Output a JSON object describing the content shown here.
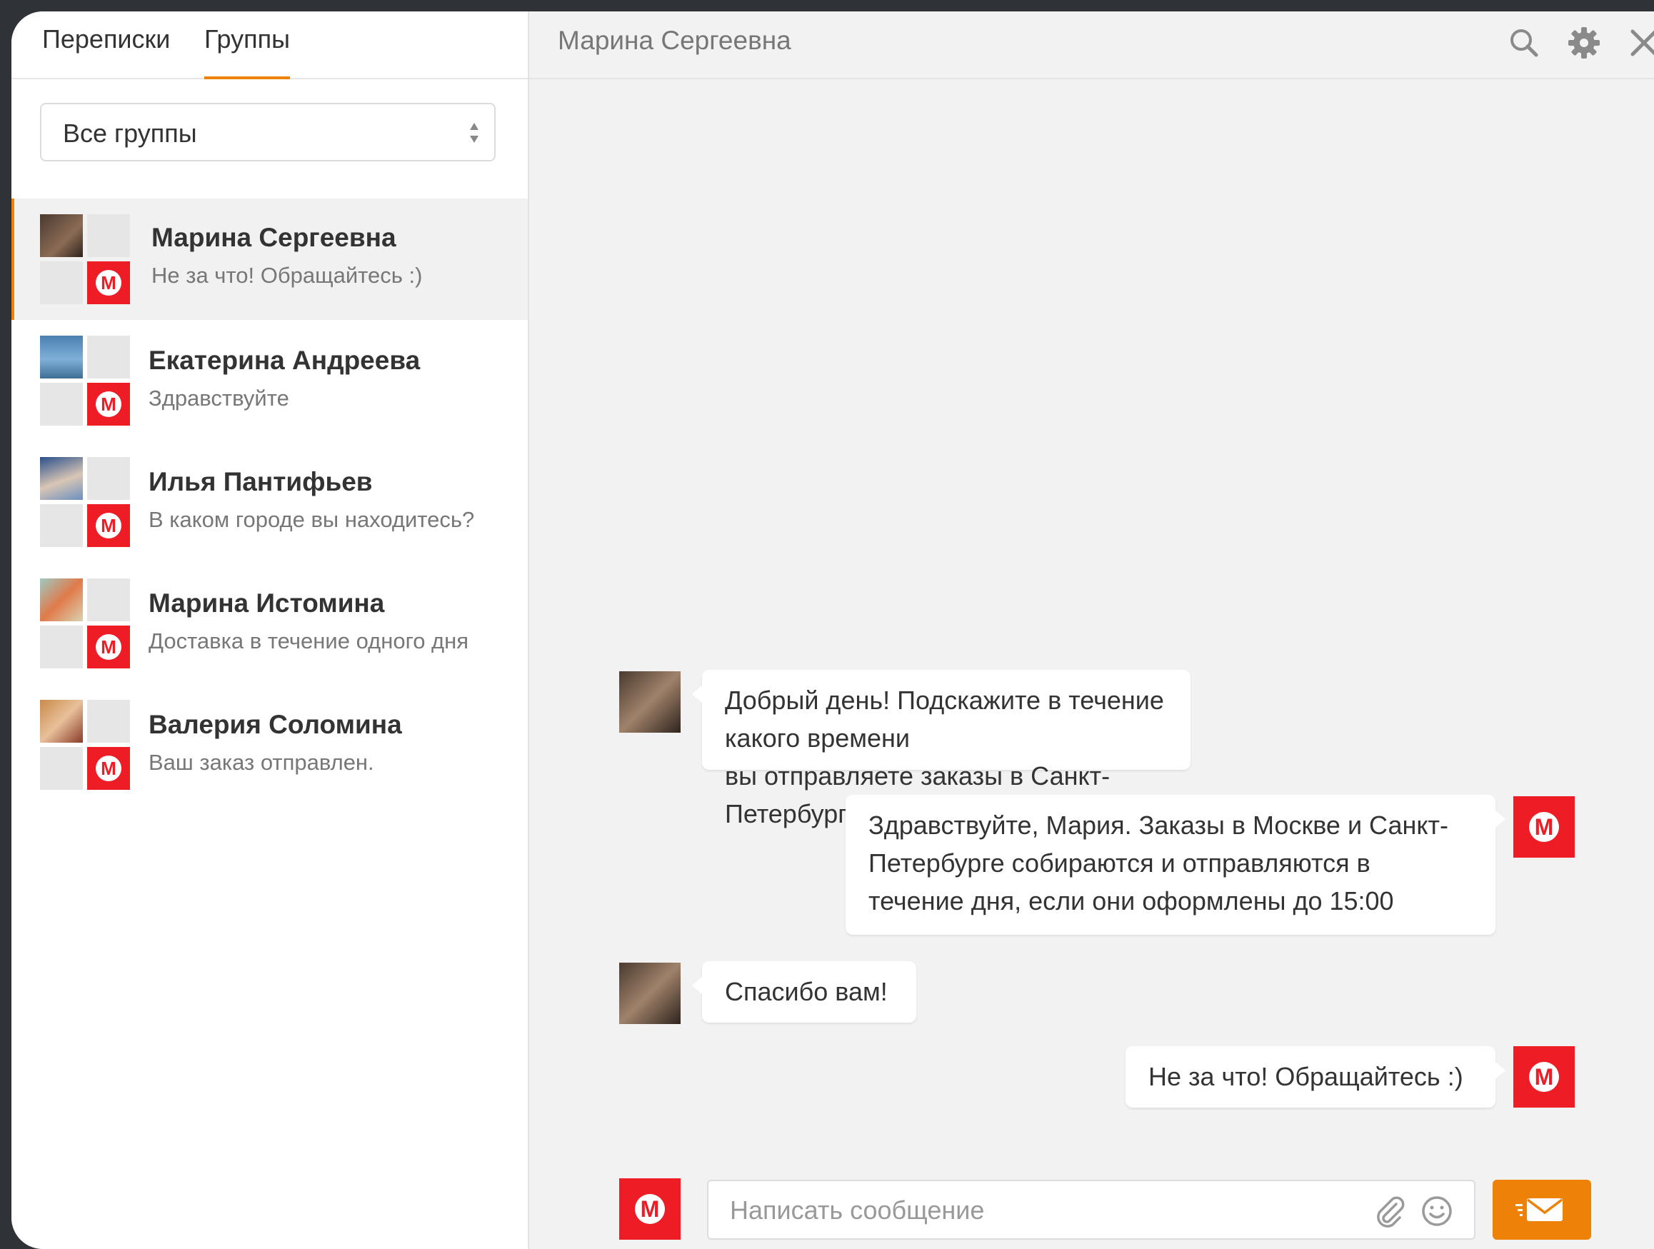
{
  "tabs": [
    "Переписки",
    "Группы"
  ],
  "group_select": {
    "value": "Все группы"
  },
  "conversations": [
    {
      "name": "Марина Сергеевна",
      "preview": "Не за что! Обращайтесь :)",
      "active": true
    },
    {
      "name": "Екатерина Андреева",
      "preview": "Здравствуйте"
    },
    {
      "name": "Илья Пантифьев",
      "preview": "В каком городе вы находитесь?"
    },
    {
      "name": "Марина Истомина",
      "preview": "Доставка в течение одного дня"
    },
    {
      "name": "Валерия Соломина",
      "preview": "Ваш заказ отправлен."
    }
  ],
  "brand_logo_letter": "М",
  "chat": {
    "title": "Марина Сергеевна",
    "messages": [
      {
        "from": "user",
        "lines": [
          "Добрый день! Подскажите в течение какого времени",
          "вы отправляете заказы в Санкт-Петербурге?"
        ]
      },
      {
        "from": "shop",
        "lines": [
          "Здравствуйте, Мария. Заказы в Москве и Санкт-",
          "Петербурге собираются и отправляются в",
          "течение дня, если они оформлены до 15:00"
        ]
      },
      {
        "from": "user",
        "lines": [
          "Спасибо вам!"
        ]
      },
      {
        "from": "shop",
        "lines": [
          "Не за что! Обращайтесь :)"
        ]
      }
    ],
    "composer_placeholder": "Написать сообщение"
  },
  "icons": {
    "search": "search-icon",
    "settings": "gear-icon",
    "close": "close-icon",
    "attach": "paperclip-icon",
    "emoji": "smiley-icon",
    "send": "send-mail-icon"
  },
  "colors": {
    "accent": "#ee8208",
    "brand_red": "#ee1c25"
  }
}
